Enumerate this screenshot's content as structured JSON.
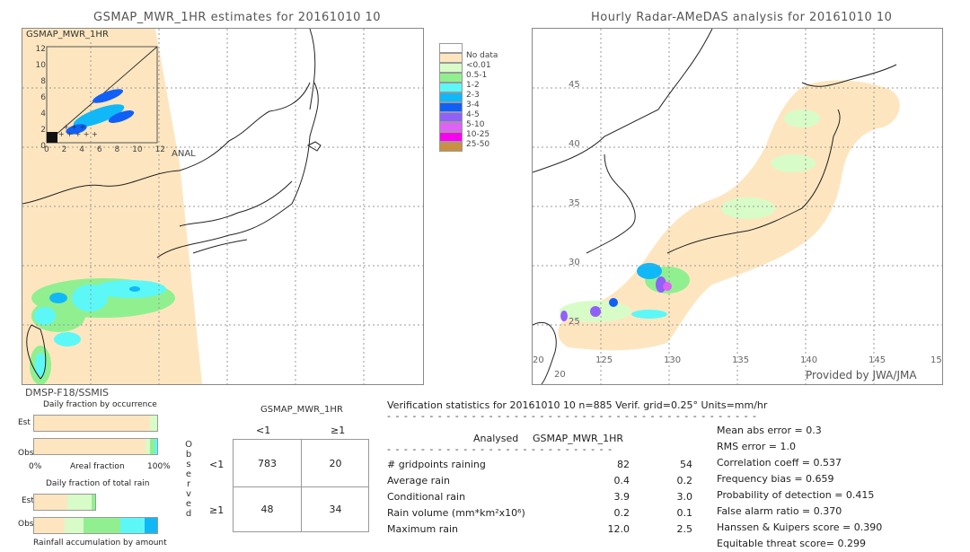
{
  "left_panel": {
    "title": "GSMAP_MWR_1HR estimates for 20161010 10",
    "inset_label": "GSMAP_MWR_1HR",
    "inset_y_ticks": [
      "12",
      "10",
      "8",
      "6",
      "4",
      "2",
      "0"
    ],
    "inset_x_ticks": [
      "0",
      "2",
      "4",
      "6",
      "8",
      "10",
      "12"
    ],
    "inset_x_label": "ANAL",
    "sensor_label": "DMSP-F18/SSMIS"
  },
  "right_panel": {
    "title": "Hourly Radar-AMeDAS analysis for 20161010 10",
    "lat_ticks": [
      "45",
      "40",
      "35",
      "30",
      "25"
    ],
    "lon_ticks": [
      "20",
      "125",
      "130",
      "135",
      "140",
      "145",
      "15"
    ],
    "bottom_lat_label": "20",
    "credit": "Provided by JWA/JMA"
  },
  "legend": {
    "items": [
      {
        "label": "",
        "color": "#ffffff"
      },
      {
        "label": "No data",
        "color": "#fde6bf"
      },
      {
        "label": "<0.01",
        "color": "#d8fcc8"
      },
      {
        "label": "0.5-1",
        "color": "#90f090"
      },
      {
        "label": "1-2",
        "color": "#5cf8f8"
      },
      {
        "label": "2-3",
        "color": "#10b8f8"
      },
      {
        "label": "3-4",
        "color": "#1060f8"
      },
      {
        "label": "4-5",
        "color": "#9060f8"
      },
      {
        "label": "5-10",
        "color": "#e060f8"
      },
      {
        "label": "10-25",
        "color": "#f800f0"
      },
      {
        "label": "25-50",
        "color": "#c89040"
      }
    ]
  },
  "occurrence": {
    "title": "Daily fraction by occurrence",
    "est_label": "Est",
    "obs_label": "Obs",
    "axis_left": "0%",
    "axis_mid": "Areal fraction",
    "axis_right": "100%",
    "est_segments": [
      {
        "fraction": 0.94,
        "color": "#fde6bf"
      },
      {
        "fraction": 0.06,
        "color": "#d8fcc8"
      }
    ],
    "obs_segments": [
      {
        "fraction": 0.905,
        "color": "#fde6bf"
      },
      {
        "fraction": 0.04,
        "color": "#d8fcc8"
      },
      {
        "fraction": 0.035,
        "color": "#90f090"
      },
      {
        "fraction": 0.02,
        "color": "#5cf8f8"
      }
    ]
  },
  "total_rain": {
    "title": "Daily fraction of total rain",
    "est_label": "Est",
    "obs_label": "Obs",
    "footer": "Rainfall accumulation by amount",
    "est_segments": [
      {
        "fraction": 0.54,
        "color": "#fde6bf"
      },
      {
        "fraction": 0.4,
        "color": "#d8fcc8"
      },
      {
        "fraction": 0.06,
        "color": "#90f090"
      }
    ],
    "obs_segments": [
      {
        "fraction": 0.245,
        "color": "#fde6bf"
      },
      {
        "fraction": 0.155,
        "color": "#d8fcc8"
      },
      {
        "fraction": 0.3,
        "color": "#90f090"
      },
      {
        "fraction": 0.195,
        "color": "#5cf8f8"
      },
      {
        "fraction": 0.105,
        "color": "#10b8f8"
      }
    ]
  },
  "contingency": {
    "header": "GSMAP_MWR_1HR",
    "col_labels": [
      "<1",
      "≥1"
    ],
    "row_labels": [
      "<1",
      "≥1"
    ],
    "side_label": [
      "O",
      "b",
      "s",
      "e",
      "r",
      "v",
      "e",
      "d"
    ],
    "cells": [
      [
        "783",
        "20"
      ],
      [
        "48",
        "34"
      ]
    ]
  },
  "verification": {
    "header": "Verification statistics for 20161010 10   n=885   Verif. grid=0.25°   Units=mm/hr",
    "col_analysed": "Analysed",
    "col_model": "GSMAP_MWR_1HR",
    "rows": [
      {
        "label": "# gridpoints raining",
        "analysed": "82",
        "model": "54"
      },
      {
        "label": "Average rain",
        "analysed": "0.4",
        "model": "0.2"
      },
      {
        "label": "Conditional rain",
        "analysed": "3.9",
        "model": "3.0"
      },
      {
        "label": "Rain volume (mm*km²x10⁶)",
        "analysed": "0.2",
        "model": "0.1"
      },
      {
        "label": "Maximum rain",
        "analysed": "12.0",
        "model": "2.5"
      }
    ],
    "scores": [
      "Mean abs error = 0.3",
      "RMS error = 1.0",
      "Correlation coeff = 0.537",
      "Frequency bias = 0.659",
      "Probability of detection = 0.415",
      "False alarm ratio = 0.370",
      "Hanssen & Kuipers score = 0.390",
      "Equitable threat score= 0.299"
    ]
  },
  "chart_data": {
    "type": "table",
    "title": "Verification statistics for 20161010 10",
    "n": 885,
    "grid": "0.25°",
    "units": "mm/hr",
    "contingency": {
      "obs_lt1_est_lt1": 783,
      "obs_lt1_est_ge1": 20,
      "obs_ge1_est_lt1": 48,
      "obs_ge1_est_ge1": 34
    },
    "stats": {
      "gridpoints_raining": {
        "analysed": 82,
        "model": 54
      },
      "average_rain": {
        "analysed": 0.4,
        "model": 0.2
      },
      "conditional_rain": {
        "analysed": 3.9,
        "model": 3.0
      },
      "rain_volume": {
        "analysed": 0.2,
        "model": 0.1
      },
      "maximum_rain": {
        "analysed": 12.0,
        "model": 2.5
      }
    },
    "scores": {
      "mean_abs_error": 0.3,
      "rms_error": 1.0,
      "correlation": 0.537,
      "frequency_bias": 0.659,
      "pod": 0.415,
      "far": 0.37,
      "hanssen_kuipers": 0.39,
      "ets": 0.299
    }
  }
}
